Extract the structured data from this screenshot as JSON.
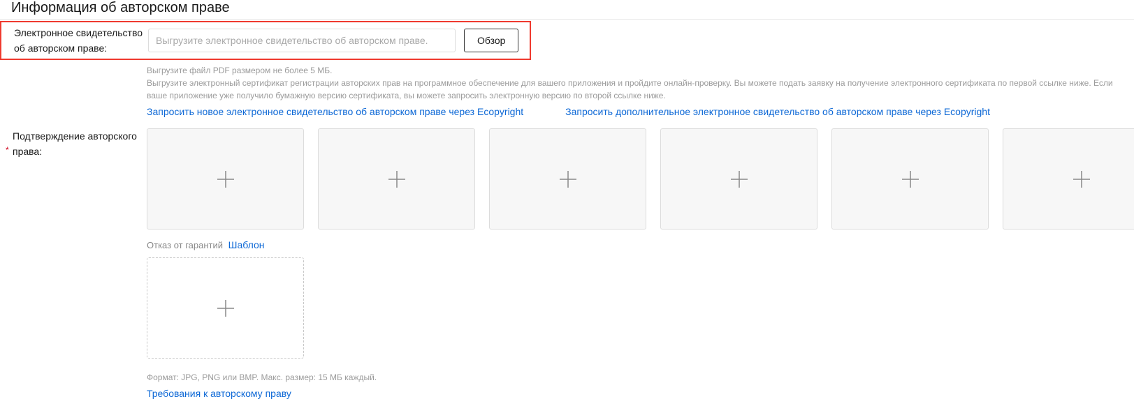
{
  "section_title": "Информация об авторском праве",
  "certificate": {
    "label": "Электронное свидетельство об авторском праве:",
    "placeholder": "Выгрузите электронное свидетельство об авторском праве.",
    "browse_label": "Обзор",
    "hint_size": "Выгрузите файл PDF размером не более 5 МБ.",
    "hint_desc": "Выгрузите электронный сертификат регистрации авторских прав на программное обеспечение для вашего приложения и пройдите онлайн-проверку. Вы можете подать заявку на получение электронного сертификата по первой ссылке ниже. Если ваше приложение уже получило бумажную версию сертификата, вы можете запросить электронную версию по второй ссылке ниже.",
    "link_new": "Запросить новое электронное свидетельство об авторском праве через Ecopyright",
    "link_additional": "Запросить дополнительное электронное свидетельство об авторском праве через Ecopyright"
  },
  "confirmation": {
    "label": "Подтверждение авторского права:"
  },
  "disclaimer": {
    "prefix": "Отказ от гарантий",
    "template_link": "Шаблон"
  },
  "format_hint": "Формат: JPG, PNG или BMP. Макс. размер: 15 МБ каждый.",
  "requirements_link": "Требования к авторскому праву"
}
